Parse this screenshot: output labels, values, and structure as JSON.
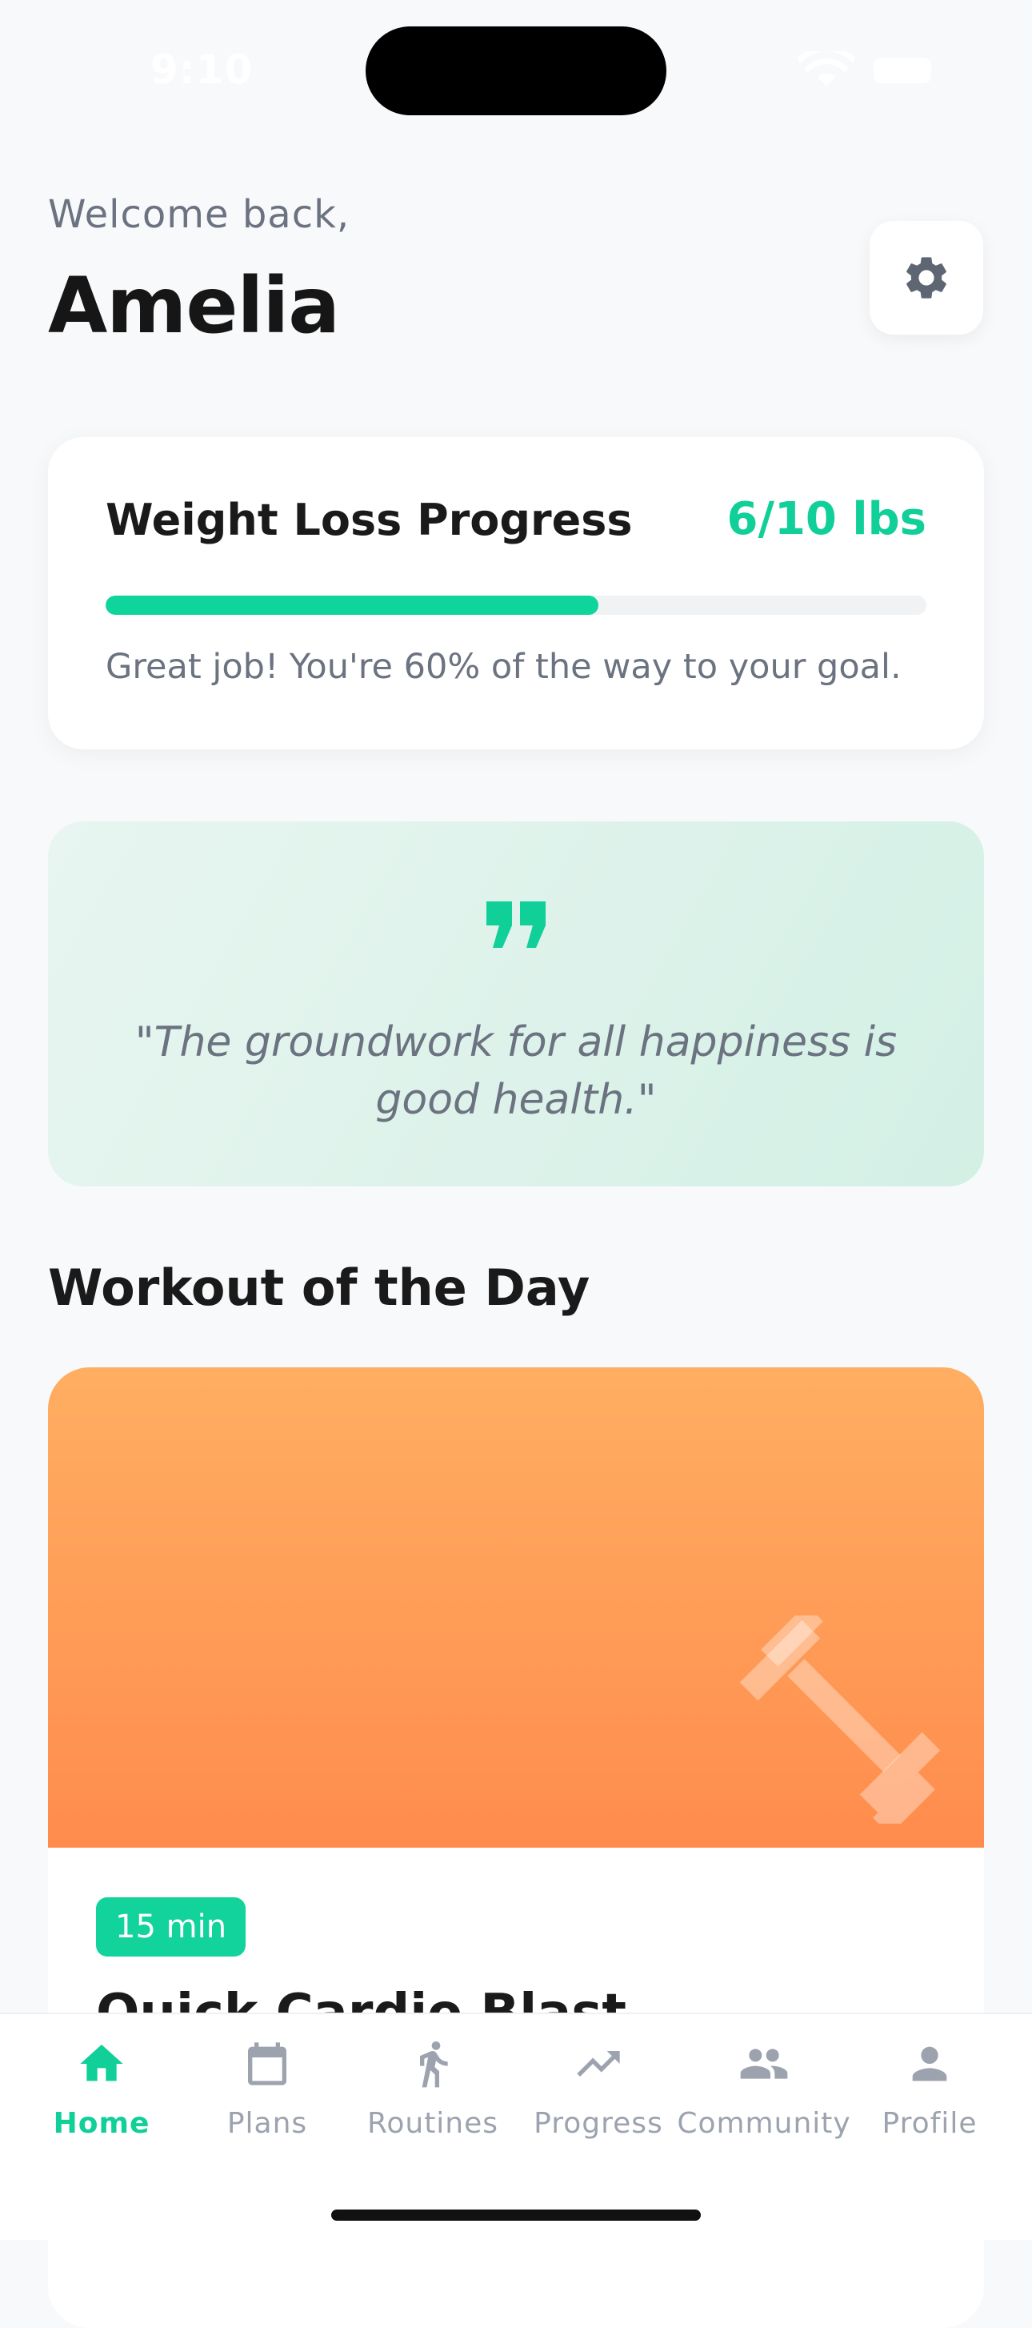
{
  "status_bar": {
    "time": "9:10"
  },
  "header": {
    "greeting": "Welcome back,",
    "user_name": "Amelia"
  },
  "progress_card": {
    "title": "Weight Loss Progress",
    "value_text": "6/10 lbs",
    "progress_fraction": 0.6,
    "message": "Great job! You're 60% of the way to your goal."
  },
  "quote": {
    "text": "\"The groundwork for all happiness is good health.\""
  },
  "workout": {
    "section_title": "Workout of the Day",
    "duration": "15 min",
    "title": "Quick Cardio Blast"
  },
  "nav": {
    "items": [
      {
        "label": "Home",
        "icon": "home-icon",
        "active": true
      },
      {
        "label": "Plans",
        "icon": "calendar-icon",
        "active": false
      },
      {
        "label": "Routines",
        "icon": "running-icon",
        "active": false
      },
      {
        "label": "Progress",
        "icon": "trending-up-icon",
        "active": false
      },
      {
        "label": "Community",
        "icon": "people-icon",
        "active": false
      },
      {
        "label": "Profile",
        "icon": "person-icon",
        "active": false
      }
    ]
  },
  "colors": {
    "accent": "#10cf98",
    "muted_text": "#6b7280",
    "nav_inactive": "#9ca3af",
    "banner_top": "#ffae62",
    "banner_bottom": "#ff8c4d"
  }
}
